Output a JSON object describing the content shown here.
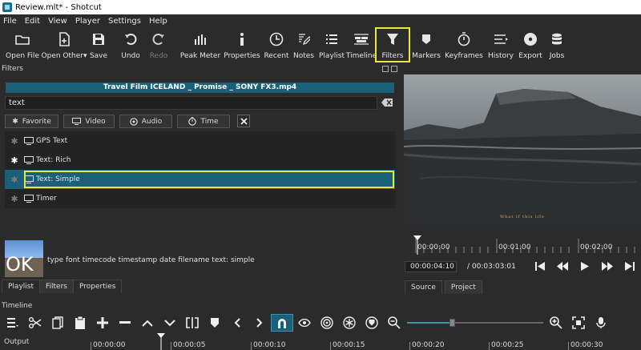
{
  "window": {
    "title": "Review.mlt* - Shotcut"
  },
  "menu": [
    "File",
    "Edit",
    "View",
    "Player",
    "Settings",
    "Help"
  ],
  "toolbar": [
    {
      "id": "open-file",
      "label": "Open File",
      "icon": "folder-open-icon"
    },
    {
      "id": "open-other",
      "label": "Open Other",
      "icon": "file-icon"
    },
    {
      "id": "save",
      "label": "Save",
      "icon": "floppy-icon"
    },
    {
      "id": "undo",
      "label": "Undo",
      "icon": "undo-icon"
    },
    {
      "id": "redo",
      "label": "Redo",
      "icon": "redo-icon",
      "disabled": true
    },
    {
      "id": "peak-meter",
      "label": "Peak Meter",
      "icon": "meter-icon"
    },
    {
      "id": "properties",
      "label": "Properties",
      "icon": "info-icon"
    },
    {
      "id": "recent",
      "label": "Recent",
      "icon": "clock-icon"
    },
    {
      "id": "notes",
      "label": "Notes",
      "icon": "pencil-icon"
    },
    {
      "id": "playlist",
      "label": "Playlist",
      "icon": "list-icon"
    },
    {
      "id": "timeline",
      "label": "Timeline",
      "icon": "timeline-icon"
    },
    {
      "id": "filters",
      "label": "Filters",
      "icon": "funnel-icon",
      "active": true
    },
    {
      "id": "markers",
      "label": "Markers",
      "icon": "bookmark-icon"
    },
    {
      "id": "keyframes",
      "label": "Keyframes",
      "icon": "stopwatch-icon"
    },
    {
      "id": "history",
      "label": "History",
      "icon": "history-icon"
    },
    {
      "id": "export",
      "label": "Export",
      "icon": "disc-icon"
    },
    {
      "id": "jobs",
      "label": "Jobs",
      "icon": "database-icon"
    }
  ],
  "filters_panel": {
    "title": "Filters",
    "clip_name": "Travel Film ICELAND _ Promise _ SONY FX3.mp4",
    "search_value": "text",
    "categories": [
      "Favorite",
      "Video",
      "Audio",
      "Time"
    ],
    "items": [
      {
        "label": "GPS Text",
        "favorite": false,
        "selected": false
      },
      {
        "label": "Text: Rich",
        "favorite": true,
        "selected": false
      },
      {
        "label": "Text: Simple",
        "favorite": false,
        "selected": true
      },
      {
        "label": "Timer",
        "favorite": false,
        "selected": false
      }
    ],
    "preview_text": "OK",
    "description": "type font timecode timestamp date filename text: simple",
    "tabs": [
      "Playlist",
      "Filters",
      "Properties"
    ],
    "active_tab": "Filters"
  },
  "player": {
    "subtitle": "What if this life",
    "ruler_labels": [
      "00:00:00",
      "00:01:00",
      "00:02:00"
    ],
    "current_time": "00:00:04:10",
    "total_time": "/ 00:03:03:01",
    "tabs": [
      "Source",
      "Project"
    ],
    "active_tab": "Project"
  },
  "timeline": {
    "title": "Timeline",
    "track_label": "Output",
    "ruler_labels": [
      "00:00:00",
      "00:00:05",
      "00:00:10",
      "00:00:15",
      "00:00:20",
      "00:00:25",
      "00:00:30"
    ],
    "zoom_level": 0.33
  },
  "colors": {
    "background": "#2b2b2b",
    "selection": "#1c5f78",
    "highlight": "#e8e83a"
  }
}
